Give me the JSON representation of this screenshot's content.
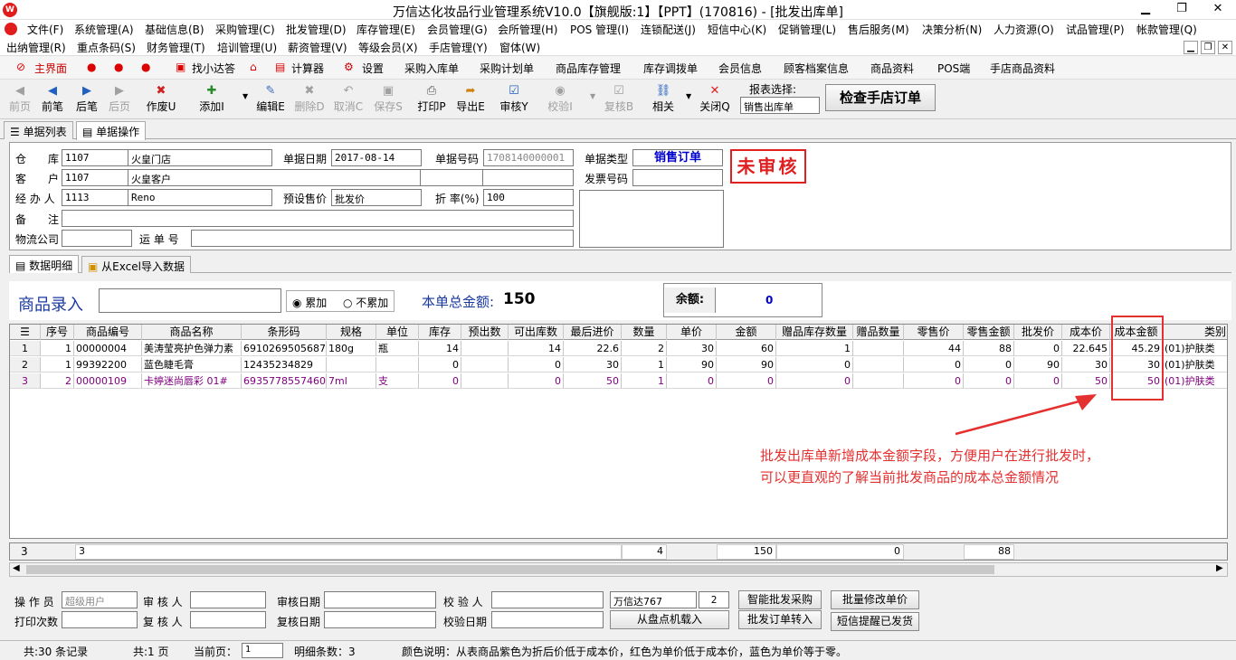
{
  "window": {
    "title": "万信达化妆品行业管理系统V10.0【旗舰版:1】【PPT】(170816) - [批发出库单]",
    "min": "▁",
    "max": "❐",
    "close": "✕"
  },
  "menu1": [
    "文件(F)",
    "系统管理(A)",
    "基础信息(B)",
    "采购管理(C)",
    "批发管理(D)",
    "库存管理(E)",
    "会员管理(G)",
    "会所管理(H)",
    "POS 管理(I)",
    "连锁配送(J)",
    "短信中心(K)",
    "促销管理(L)",
    "售后服务(M)",
    "决策分析(N)",
    "人力资源(O)",
    "试品管理(P)",
    "帐款管理(Q)"
  ],
  "menu2": [
    "出纳管理(R)",
    "重点条码(S)",
    "财务管理(T)",
    "培训管理(U)",
    "薪资管理(V)",
    "等级会员(X)",
    "手店管理(Y)",
    "窗体(W)"
  ],
  "quick": {
    "home": "主界面",
    "find": "找小达答",
    "calc": "计算器",
    "settings": "设置",
    "items": [
      "采购入库单",
      "采购计划单",
      "商品库存管理",
      "库存调拨单",
      "会员信息",
      "顾客档案信息",
      "商品资料",
      "POS端",
      "手店商品资料"
    ]
  },
  "tools": [
    {
      "l": "前页",
      "i": "◀",
      "d": true
    },
    {
      "l": "前笔",
      "i": "◀",
      "d": false
    },
    {
      "l": "后笔",
      "i": "▶",
      "d": false
    },
    {
      "l": "后页",
      "i": "▶",
      "d": true
    },
    {
      "l": "作废U",
      "i": "✖",
      "d": false
    },
    {
      "l": "添加I",
      "i": "✚",
      "d": false
    },
    {
      "l": "编辑E",
      "i": "✎",
      "d": false
    },
    {
      "l": "删除D",
      "i": "✖",
      "d": true
    },
    {
      "l": "取消C",
      "i": "↶",
      "d": true
    },
    {
      "l": "保存S",
      "i": "▣",
      "d": true
    },
    {
      "l": "打印P",
      "i": "⎙",
      "d": false
    },
    {
      "l": "导出E",
      "i": "➦",
      "d": false
    },
    {
      "l": "审核Y",
      "i": "☑",
      "d": false
    },
    {
      "l": "校验I",
      "i": "◉",
      "d": true
    },
    {
      "l": "复核B",
      "i": "☑",
      "d": true
    },
    {
      "l": "相关",
      "i": "⛓",
      "d": false
    },
    {
      "l": "关闭Q",
      "i": "✕",
      "d": false
    }
  ],
  "report": {
    "label": "报表选择:",
    "value": "销售出库单",
    "check_btn": "检查手店订单"
  },
  "tabs": {
    "list": "单据列表",
    "op": "单据操作"
  },
  "form": {
    "warehouse_lbl": "仓　　库",
    "warehouse_code": "1107",
    "warehouse_name": "火皇门店",
    "date_lbl": "单据日期",
    "date": "2017-08-14",
    "no_lbl": "单据号码",
    "no": "1708140000001",
    "type_lbl": "单据类型",
    "type": "销售订单",
    "status": "未审核",
    "customer_lbl": "客　　户",
    "customer_code": "1107",
    "customer_name": "火皇客户",
    "invoice_lbl": "发票号码",
    "handler_lbl": "经 办 人",
    "handler_code": "1113",
    "handler_name": "Reno",
    "preset_lbl": "预设售价",
    "preset": "批发价",
    "discount_lbl": "折 率(%)",
    "discount": "100",
    "remark_lbl": "备　　注",
    "logistics_lbl": "物流公司",
    "waybill_lbl": "运 单 号"
  },
  "tabs2": {
    "detail": "数据明细",
    "excel": "从Excel导入数据"
  },
  "entry": {
    "label": "商品录入",
    "accum": "累加",
    "no_accum": "不累加",
    "total_lbl": "本单总金额:",
    "total": "150",
    "balance_lbl": "余额:",
    "balance": "0"
  },
  "grid": {
    "headers": [
      "",
      "序号",
      "商品编号",
      "商品名称",
      "条形码",
      "规格",
      "单位",
      "库存",
      "预出数",
      "可出库数",
      "最后进价",
      "数量",
      "单价",
      "金额",
      "赠品库存数量",
      "赠品数量",
      "零售价",
      "零售金额",
      "批发价",
      "成本价",
      "成本金额",
      "类别"
    ],
    "rows": [
      {
        "n": "1",
        "seq": "1",
        "code": "00000004",
        "name": "美涛莹亮护色弹力素",
        "barcode": "6910269505687",
        "spec": "180g",
        "unit": "瓶",
        "stock": "14",
        "pre": "",
        "avail": "14",
        "last": "22.6",
        "qty": "2",
        "price": "30",
        "amt": "60",
        "gstock": "1",
        "gqty": "",
        "retail": "44",
        "ramt": "88",
        "whole": "0",
        "cost": "22.645",
        "camt": "45.29",
        "cat": "(01)护肤类"
      },
      {
        "n": "2",
        "seq": "1",
        "code": "99392200",
        "name": "蓝色睫毛膏",
        "barcode": "12435234829",
        "spec": "",
        "unit": "",
        "stock": "0",
        "pre": "",
        "avail": "0",
        "last": "30",
        "qty": "1",
        "price": "90",
        "amt": "90",
        "gstock": "0",
        "gqty": "",
        "retail": "0",
        "ramt": "0",
        "whole": "90",
        "cost": "30",
        "camt": "30",
        "cat": "(01)护肤类"
      },
      {
        "n": "3",
        "seq": "2",
        "code": "00000109",
        "name": "卡婷迷尚唇彩 01#",
        "barcode": "6935778557460",
        "spec": "7ml",
        "unit": "支",
        "stock": "0",
        "pre": "",
        "avail": "0",
        "last": "50",
        "qty": "1",
        "price": "0",
        "amt": "0",
        "gstock": "0",
        "gqty": "",
        "retail": "0",
        "ramt": "0",
        "whole": "0",
        "cost": "50",
        "camt": "50",
        "cat": "(01)护肤类"
      }
    ],
    "footer": {
      "count": "3",
      "seq": "3",
      "qty": "4",
      "amt": "150",
      "gstock": "0",
      "ramt": "88"
    },
    "row3_color": "#800080"
  },
  "annotation": {
    "line1": "批发出库单新增成本金额字段，方便用户在进行批发时，",
    "line2": "可以更直观的了解当前批发商品的成本总金额情况"
  },
  "bottom": {
    "operator_lbl": "操 作 员",
    "operator": "超级用户",
    "auditor_lbl": "审 核 人",
    "audit_date_lbl": "审核日期",
    "checker_lbl": "校 验 人",
    "wxd": "万信达767",
    "wxd_n": "2",
    "btn_smart": "智能批发采购",
    "btn_batch": "批量修改单价",
    "printcount_lbl": "打印次数",
    "reviewer_lbl": "复 核 人",
    "review_date_lbl": "复核日期",
    "check_date_lbl": "校验日期",
    "btn_load": "从盘点机载入",
    "btn_convert": "批发订单转入",
    "btn_sms": "短信提醒已发货"
  },
  "status": {
    "records": "共:30 条记录",
    "pages": "共:1 页",
    "cur_lbl": "当前页：",
    "cur": "1",
    "details": "明细条数：3",
    "legend": "颜色说明：从表商品紫色为折后价低于成本价，红色为单价低于成本价，蓝色为单价等于零。"
  }
}
